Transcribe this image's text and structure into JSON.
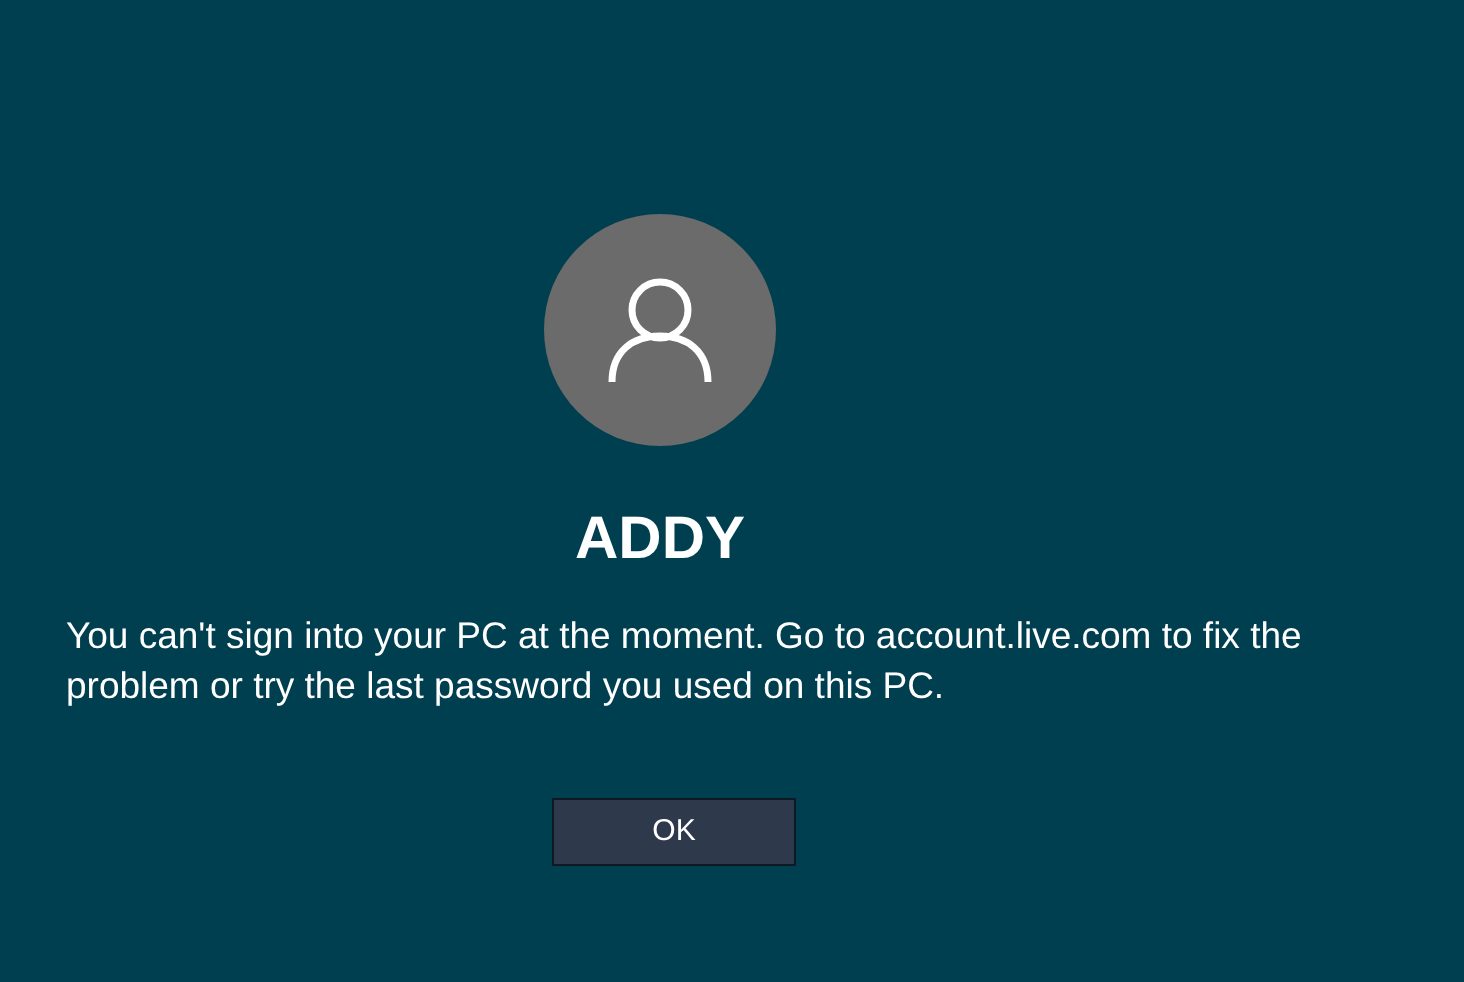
{
  "user": {
    "name": "ADDY"
  },
  "message": "You can't sign into your PC at the moment. Go to account.live.com to fix the problem or try the last password you used on this PC.",
  "buttons": [
    "OK"
  ]
}
